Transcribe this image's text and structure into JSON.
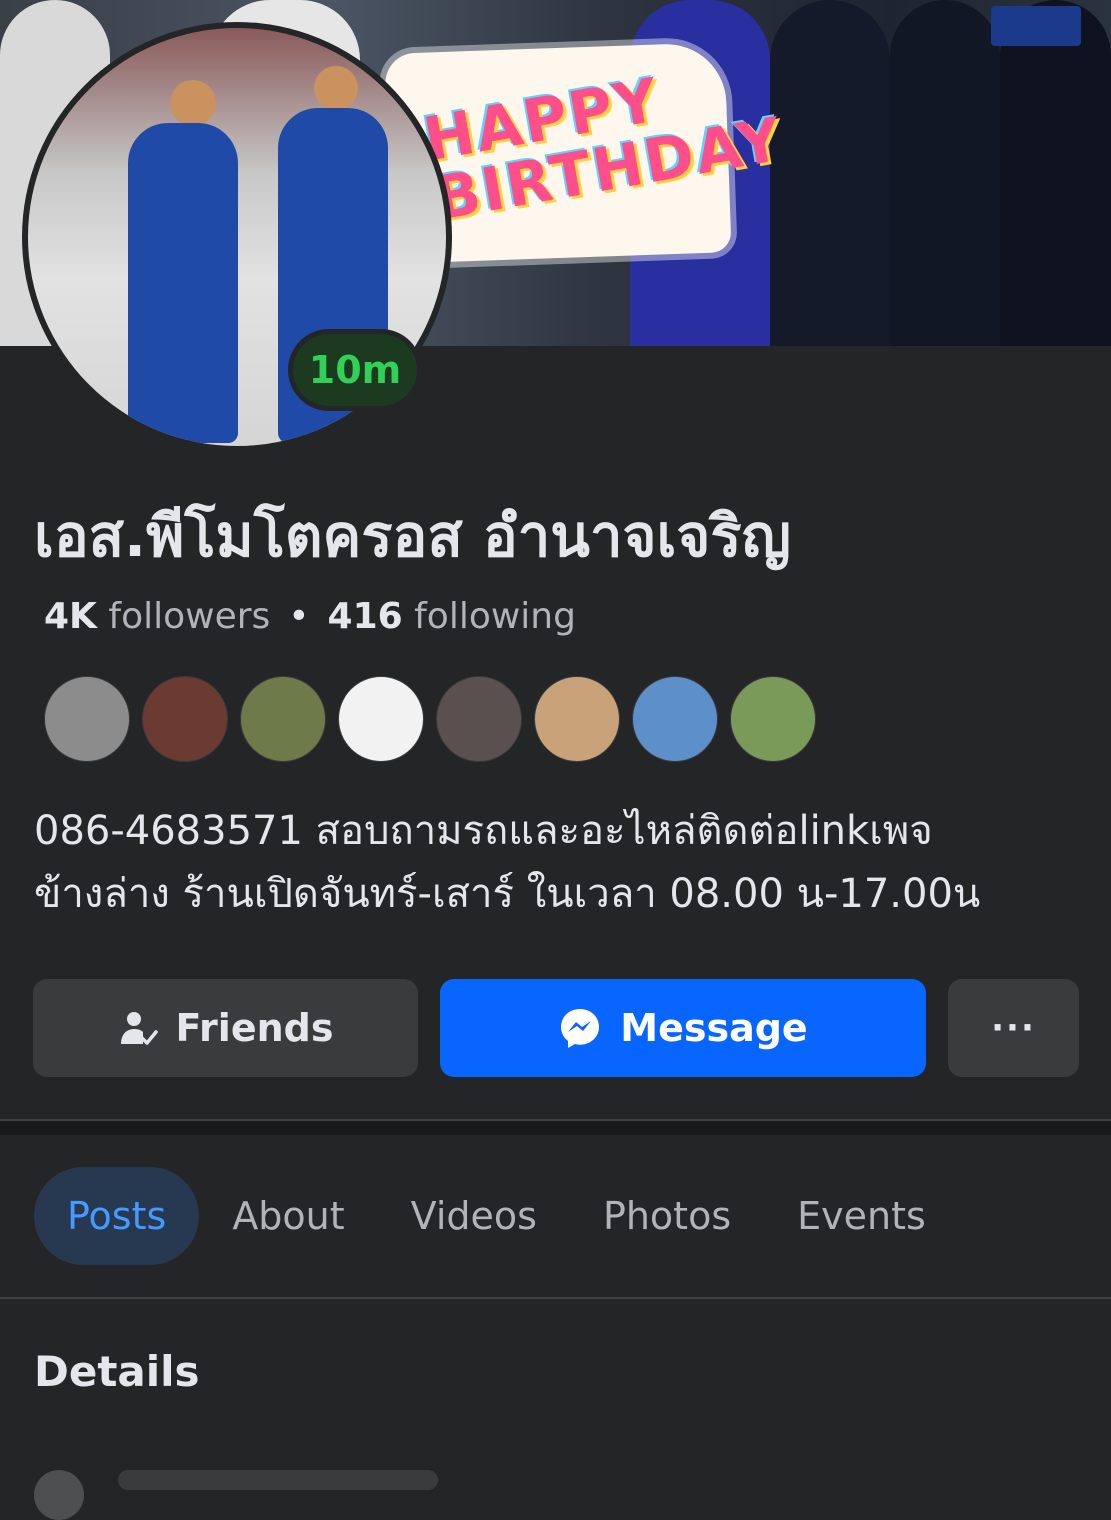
{
  "profile": {
    "name": "เอส.พีโมโตครอส อำนาจเจริญ",
    "status_time": "10m",
    "followers_count": "4K",
    "followers_label": " followers",
    "following_count": "416",
    "following_label": " following",
    "separator": "•",
    "bio_line1": "086-4683571 สอบถามรถและอะไหล่ติดต่อlinkเพจ",
    "bio_line2": "ข้างล่าง ร้านเปิดจันทร์-เสาร์ ในเวลา 08.00 น-17.00น"
  },
  "cover": {
    "sign_text": "HAPPY BIRTHDAY"
  },
  "mutual_friends": [
    {
      "color": "#8c8c8c"
    },
    {
      "color": "#6b3b32"
    },
    {
      "color": "#6e7a4a"
    },
    {
      "color": "#f2f2f2"
    },
    {
      "color": "#5a5050"
    },
    {
      "color": "#c9a27a"
    },
    {
      "color": "#5d8fc9"
    },
    {
      "color": "#7a9a5a"
    }
  ],
  "actions": {
    "friends_label": "Friends",
    "message_label": "Message",
    "more_label": "···"
  },
  "tabs": [
    {
      "label": "Posts",
      "active": true
    },
    {
      "label": "About",
      "active": false
    },
    {
      "label": "Videos",
      "active": false
    },
    {
      "label": "Photos",
      "active": false
    },
    {
      "label": "Events",
      "active": false
    }
  ],
  "sections": {
    "details_title": "Details"
  },
  "colors": {
    "background": "#242526",
    "accent_blue": "#0866ff",
    "active_tab_bg": "#263951",
    "active_tab_text": "#4599ff",
    "online_green": "#31d158"
  },
  "icons": {
    "friends": "person-check-icon",
    "message": "messenger-icon",
    "more": "more-dots-icon"
  }
}
